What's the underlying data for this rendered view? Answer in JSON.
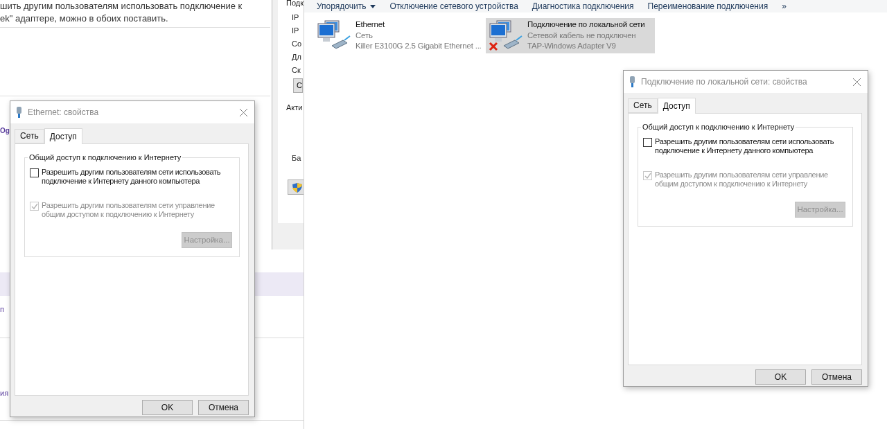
{
  "background_page": {
    "lines": [
      "шить другим пользователям использовать подключение к",
      "ek\" адаптере, можно в обоих поставить."
    ],
    "fragments": [
      {
        "text": "Og",
        "kind": "heading"
      },
      {
        "text": "п",
        "kind": "link"
      },
      {
        "text": "ия",
        "kind": "link"
      }
    ]
  },
  "status_window": {
    "labels": [
      "Подк",
      "IP",
      "IP",
      "Co",
      "Дл",
      "Ск"
    ],
    "button": "С",
    "section": "Акти",
    "label": "Ба"
  },
  "explorer": {
    "toolbar": [
      {
        "label": "Упорядочить",
        "kind": "menu"
      },
      {
        "label": "Отключение сетевого устройства",
        "kind": "command"
      },
      {
        "label": "Диагностика подключения",
        "kind": "command"
      },
      {
        "label": "Переименование подключения",
        "kind": "command"
      }
    ],
    "overflow": "»",
    "items": [
      {
        "name": "Ethernet",
        "status": "Сеть",
        "device": "Killer E3100G 2.5 Gigabit Ethernet ...",
        "selected": false,
        "disconnected": false
      },
      {
        "name": "Подключение по локальной сети",
        "status": "Сетевой кабель не подключен",
        "device": "TAP-Windows Adapter V9",
        "selected": true,
        "disconnected": true
      }
    ]
  },
  "dialogs": [
    {
      "title": "Ethernet: свойства",
      "tabs": [
        {
          "label": "Сеть",
          "selected": false
        },
        {
          "label": "Доступ",
          "selected": true
        }
      ],
      "group_title": "Общий доступ к подключению к Интернету",
      "options": [
        {
          "label": "Разрешить другим пользователям сети использовать подключение к Интернету данного компьютера",
          "checked": false,
          "disabled": false
        },
        {
          "label": "Разрешить другим пользователям сети управление общим доступом к подключению к Интернету",
          "checked": true,
          "disabled": true
        }
      ],
      "settings_button": {
        "label": "Настройка...",
        "disabled": true
      },
      "buttons": [
        "OK",
        "Отмена"
      ]
    },
    {
      "title": "Подключение по локальной сети: свойства",
      "tabs": [
        {
          "label": "Сеть",
          "selected": false
        },
        {
          "label": "Доступ",
          "selected": true
        }
      ],
      "group_title": "Общий доступ к подключению к Интернету",
      "options": [
        {
          "label": "Разрешить другим пользователям сети использовать подключение к Интернету данного компьютера",
          "checked": false,
          "disabled": false
        },
        {
          "label": "Разрешить другим пользователям сети управление общим доступом к подключению к Интернету",
          "checked": true,
          "disabled": true
        }
      ],
      "settings_button": {
        "label": "Настройка...",
        "disabled": true
      },
      "buttons": [
        "OK",
        "Отмена"
      ]
    }
  ]
}
